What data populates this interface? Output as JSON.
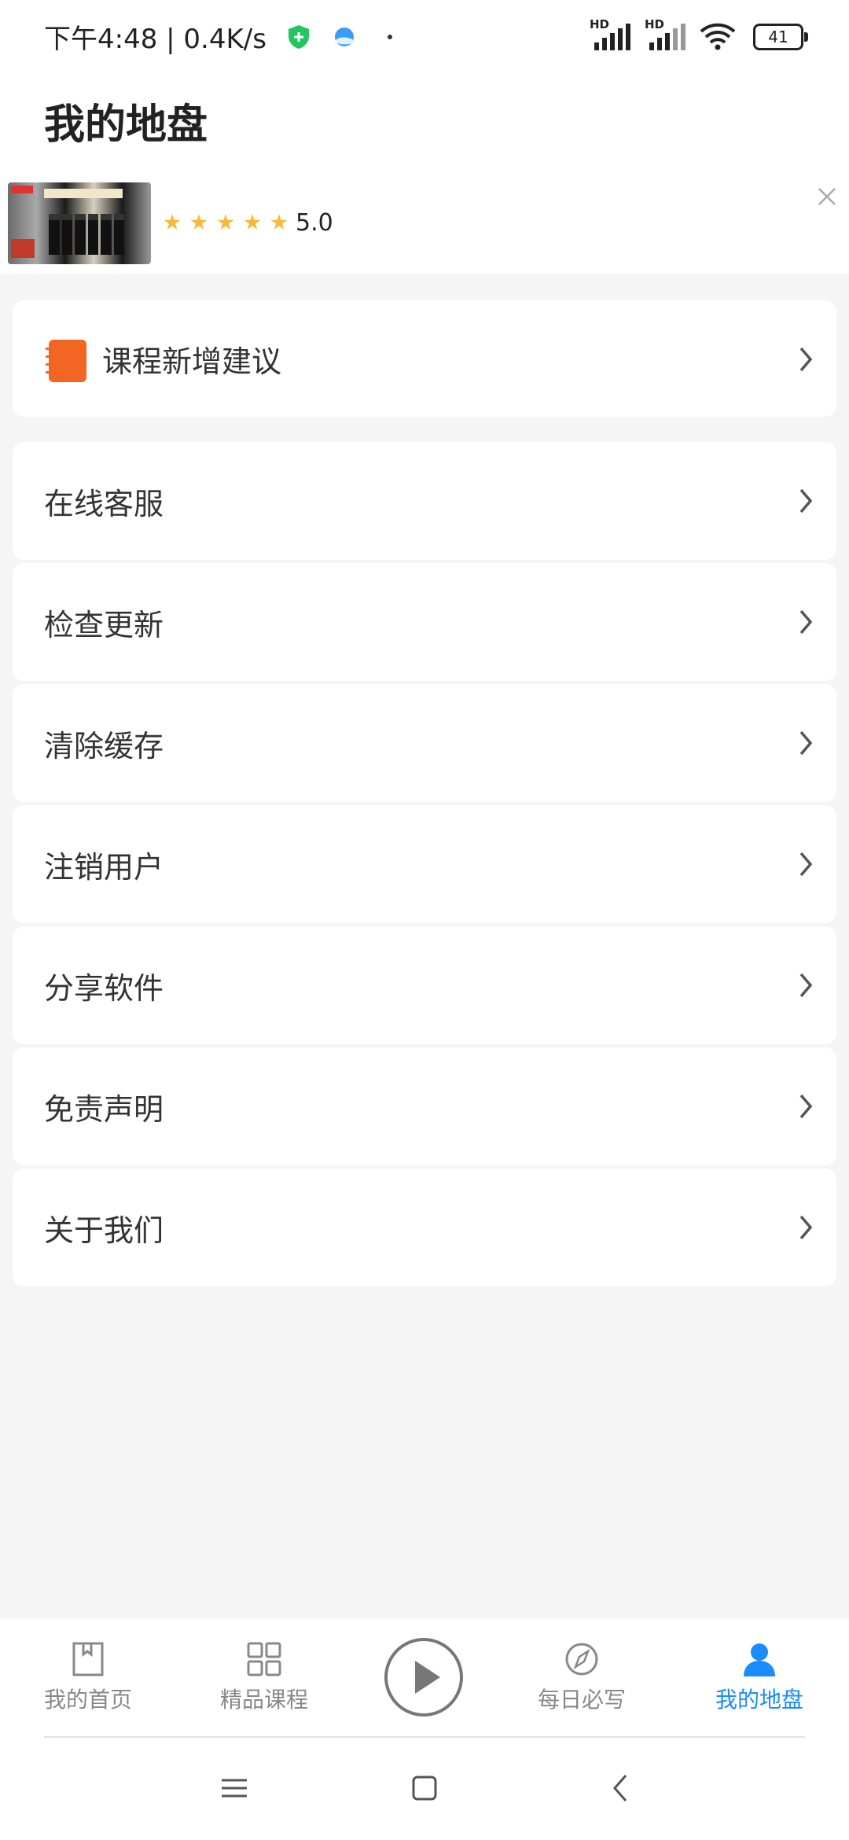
{
  "status_bar": {
    "time_speed": "下午4:48 | 0.4K/s",
    "signal_label": "HD",
    "battery": "41"
  },
  "header": {
    "title": "我的地盘"
  },
  "ad": {
    "rating": "5.0",
    "stars": 5
  },
  "menu": {
    "suggestion": "课程新增建议",
    "items": [
      {
        "label": "在线客服"
      },
      {
        "label": "检查更新"
      },
      {
        "label": "清除缓存"
      },
      {
        "label": "注销用户"
      },
      {
        "label": "分享软件"
      },
      {
        "label": "免责声明"
      },
      {
        "label": "关于我们"
      }
    ]
  },
  "tabbar": {
    "tabs": [
      {
        "label": "我的首页"
      },
      {
        "label": "精品课程"
      },
      {
        "label": "每日必写"
      },
      {
        "label": "我的地盘"
      }
    ],
    "active_tab": "我的地盘",
    "active_color": "#1a8cff"
  }
}
